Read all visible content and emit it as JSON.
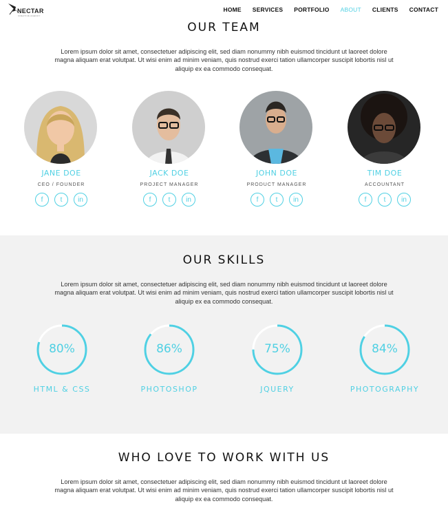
{
  "brand": {
    "name": "NECTAR",
    "tagline": "CREATIVE AGENCY"
  },
  "nav": [
    "HOME",
    "SERVICES",
    "PORTFOLIO",
    "ABOUT",
    "CLIENTS",
    "CONTACT"
  ],
  "nav_active": "ABOUT",
  "accent": "#4fd0e3",
  "team": {
    "title": "OUR TEAM",
    "lead": "Lorem ipsum dolor sit amet, consectetuer adipiscing elit, sed diam nonummy nibh euismod tincidunt ut laoreet dolore magna aliquam erat volutpat. Ut wisi enim ad minim veniam, quis nostrud exerci tation ullamcorper suscipit lobortis nisl ut aliquip ex ea commodo consequat.",
    "members": [
      {
        "name": "JANE DOE",
        "role": "CEO / FOUNDER"
      },
      {
        "name": "JACK DOE",
        "role": "PROJECT MANAGER"
      },
      {
        "name": "JOHN DOE",
        "role": "PRODUCT MANAGER"
      },
      {
        "name": "TIM DOE",
        "role": "ACCOUNTANT"
      }
    ],
    "social_icons": [
      "f",
      "t",
      "in"
    ]
  },
  "skills": {
    "title": "OUR SKILLS",
    "lead": "Lorem ipsum dolor sit amet, consectetuer adipiscing elit, sed diam nonummy nibh euismod tincidunt ut laoreet dolore magna aliquam erat volutpat. Ut wisi enim ad minim veniam, quis nostrud exerci tation ullamcorper suscipit lobortis nisl ut aliquip ex ea commodo consequat.",
    "items": [
      {
        "label": "HTML & CSS",
        "percent": 80,
        "percent_text": "80%"
      },
      {
        "label": "PHOTOSHOP",
        "percent": 86,
        "percent_text": "86%"
      },
      {
        "label": "JQUERY",
        "percent": 75,
        "percent_text": "75%"
      },
      {
        "label": "PHOTOGRAPHY",
        "percent": 84,
        "percent_text": "84%"
      }
    ]
  },
  "clients": {
    "title": "WHO LOVE TO WORK WITH US",
    "lead": "Lorem ipsum dolor sit amet, consectetuer adipiscing elit, sed diam nonummy nibh euismod tincidunt ut laoreet dolore magna aliquam erat volutpat. Ut wisi enim ad minim veniam, quis nostrud exerci tation ullamcorper suscipit lobortis nisl ut aliquip ex ea commodo consequat."
  }
}
